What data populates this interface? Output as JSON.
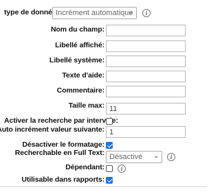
{
  "fields": {
    "data_type_label": "type de donnée:",
    "data_type_value": "Incrément automatique",
    "field_name_label": "Nom du champ:",
    "field_name_value": "",
    "display_label_label": "Libellé affiché:",
    "display_label_value": "",
    "system_label_label": "Libellé système:",
    "system_label_value": "",
    "help_text_label": "Texte d'aide:",
    "help_text_value": "",
    "comment_label": "Commentaire:",
    "comment_value": "",
    "max_size_label": "Taille max:",
    "max_size_value": "11",
    "range_search_label": "Activer la recherche par intervale:",
    "range_search_checked": false,
    "auto_increment_label": "Auto incrément valeur suivante:",
    "auto_increment_value": "1",
    "disable_formatting_label": "Désactiver le formatage:",
    "disable_formatting_checked": true,
    "fulltext_label": "Recherchable en Full Text:",
    "fulltext_value": "Désactivé",
    "dependent_label": "Dépendant:",
    "dependent_checked": false,
    "usable_reports_label": "Utilisable dans rapports:",
    "usable_reports_checked": true
  },
  "icons": {
    "info_glyph": "i",
    "chevron_glyph": "⌄"
  },
  "colors": {
    "checkbox_checked": "#1a73e8"
  }
}
